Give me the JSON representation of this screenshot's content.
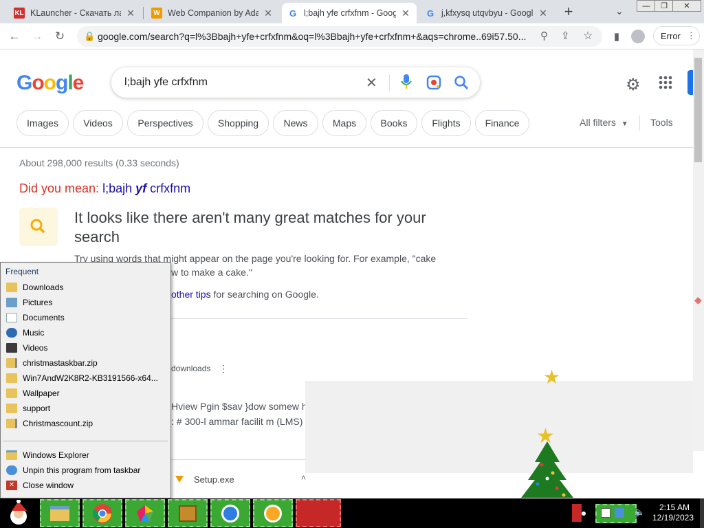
{
  "tabs": [
    {
      "favicon": "KL",
      "favicon_color": "#d32f2f",
      "title": "KLauncher - Скачать лау"
    },
    {
      "favicon": "W",
      "favicon_color": "#f29900",
      "title": "Web Companion by Adaw"
    },
    {
      "favicon": "G",
      "favicon_color": "#4285f4",
      "title": "l;bajh yfe crfxfnm - Goog"
    },
    {
      "favicon": "G",
      "favicon_color": "#4285f4",
      "title": "j,kfxysq utqvbyu - Google"
    }
  ],
  "toolbar": {
    "url": "google.com/search?q=l%3Bbajh+yfe+crfxfnm&oq=l%3Bbajh+yfe+crfxfnm+&aqs=chrome..69i57.50...",
    "error_label": "Error"
  },
  "search": {
    "logo_text": "Google",
    "query": "l;bajh yfe crfxfnm"
  },
  "filter_chips": [
    "Images",
    "Videos",
    "Perspectives",
    "Shopping",
    "News",
    "Maps",
    "Books",
    "Flights",
    "Finance"
  ],
  "filters": {
    "all_filters": "All filters",
    "tools": "Tools"
  },
  "results": {
    "stats": "About 298,000 results (0.33 seconds)",
    "did_you_mean_label": "Did you mean:",
    "did_you_mean_part1": "l;bajh",
    "did_you_mean_bold": "yf",
    "did_you_mean_part2": "crfxfnm",
    "no_match_heading_line1": "It looks like there aren't many great matches for your",
    "no_match_heading_line2": "search",
    "tip_line1": "Try using words that might appear on the page you're looking for. For example, \"cake",
    "tip_line2": "w to make a cake.\"",
    "other_tips_link": "other tips",
    "other_tips_rest": "for searching on Google.",
    "snippet_downloads": "downloads",
    "snippet_line1": "Hview Pgin $sav }dow somew ht",
    "snippet_line2": ": # 300-l ammar facilit m (LMS)",
    "download_file": "Setup.exe"
  },
  "jump_list": {
    "header": "Frequent",
    "items": [
      {
        "label": "Downloads",
        "icon": "downloads-folder-icon"
      },
      {
        "label": "Pictures",
        "icon": "pictures-folder-icon"
      },
      {
        "label": "Documents",
        "icon": "documents-icon"
      },
      {
        "label": "Music",
        "icon": "music-icon"
      },
      {
        "label": "Videos",
        "icon": "videos-icon"
      },
      {
        "label": "christmastaskbar.zip",
        "icon": "zip-folder-icon"
      },
      {
        "label": "Win7AndW2K8R2-KB3191566-x64...",
        "icon": "folder-icon"
      },
      {
        "label": "Wallpaper",
        "icon": "folder-icon"
      },
      {
        "label": "support",
        "icon": "folder-icon"
      },
      {
        "label": "Christmascount.zip",
        "icon": "zip-folder-icon"
      }
    ],
    "actions": [
      {
        "label": "Windows Explorer",
        "icon": "windows-explorer-icon"
      },
      {
        "label": "Unpin this program from taskbar",
        "icon": "unpin-icon"
      },
      {
        "label": "Close window",
        "icon": "close-window-icon"
      }
    ]
  },
  "clock": {
    "time": "2:15 AM",
    "date": "12/19/2023"
  },
  "colors": {
    "link": "#1a0dab",
    "did_you_mean": "#d93025",
    "accent": "#1a73e8"
  }
}
